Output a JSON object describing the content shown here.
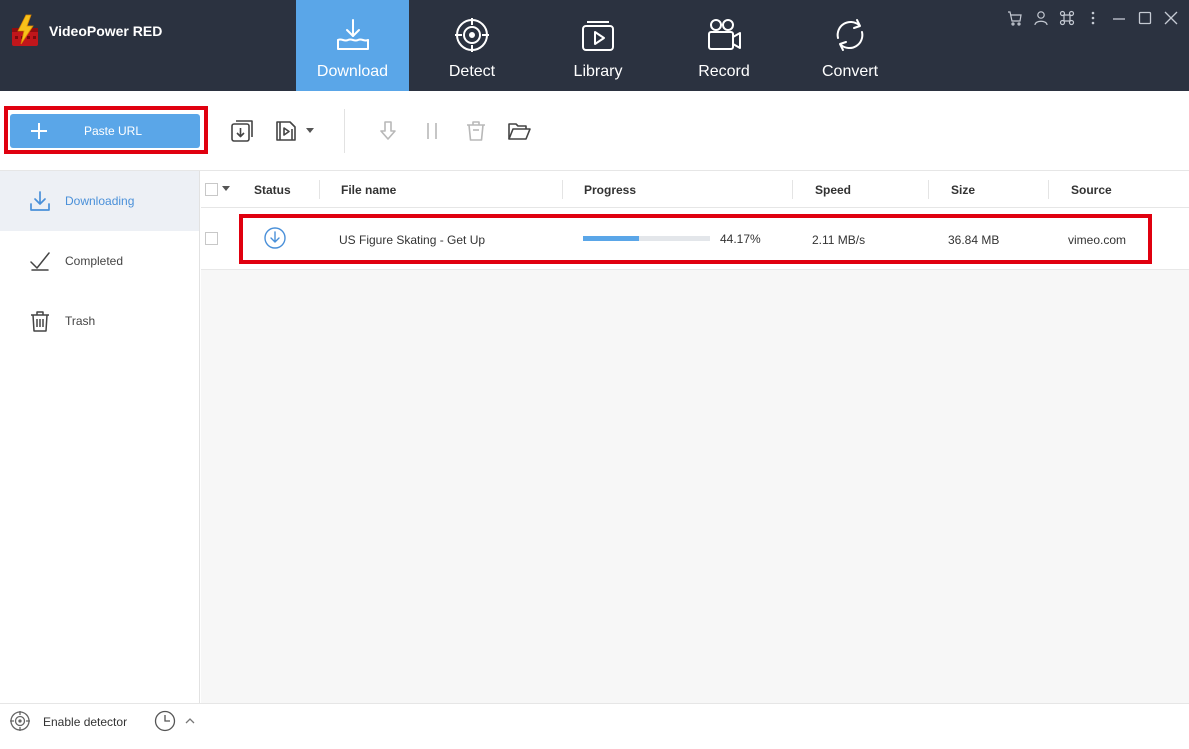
{
  "app": {
    "title": "VideoPower RED"
  },
  "nav": {
    "tabs": [
      {
        "label": "Download",
        "icon": "download-tray-icon",
        "active": true
      },
      {
        "label": "Detect",
        "icon": "target-icon"
      },
      {
        "label": "Library",
        "icon": "video-library-icon"
      },
      {
        "label": "Record",
        "icon": "video-camera-icon"
      },
      {
        "label": "Convert",
        "icon": "convert-cycle-icon"
      }
    ]
  },
  "window_controls": [
    "cart-icon",
    "user-icon",
    "command-icon",
    "more-vertical-icon",
    "minimize-icon",
    "maximize-icon",
    "close-icon"
  ],
  "toolbar": {
    "paste_url_label": "Paste URL",
    "tools": [
      "import-download-icon",
      "video-download-icon",
      "resume-download-icon",
      "pause-icon",
      "delete-icon",
      "open-folder-icon"
    ]
  },
  "sidebar": {
    "items": [
      {
        "label": "Downloading",
        "icon": "download-icon",
        "active": true
      },
      {
        "label": "Completed",
        "icon": "checkmark-doc-icon"
      },
      {
        "label": "Trash",
        "icon": "trash-icon"
      }
    ]
  },
  "table": {
    "columns": [
      "Status",
      "File name",
      "Progress",
      "Speed",
      "Size",
      "Source"
    ],
    "rows": [
      {
        "status": "downloading",
        "file_name": "US Figure Skating - Get Up",
        "progress": 0.4417,
        "progress_text": "44.17%",
        "speed": "2.11 MB/s",
        "size": "36.84 MB",
        "source": "vimeo.com"
      }
    ]
  },
  "statusbar": {
    "detector_label": "Enable detector"
  },
  "colors": {
    "accent": "#5aa6e8",
    "topbar": "#2b3240",
    "highlight": "#e0000f"
  }
}
